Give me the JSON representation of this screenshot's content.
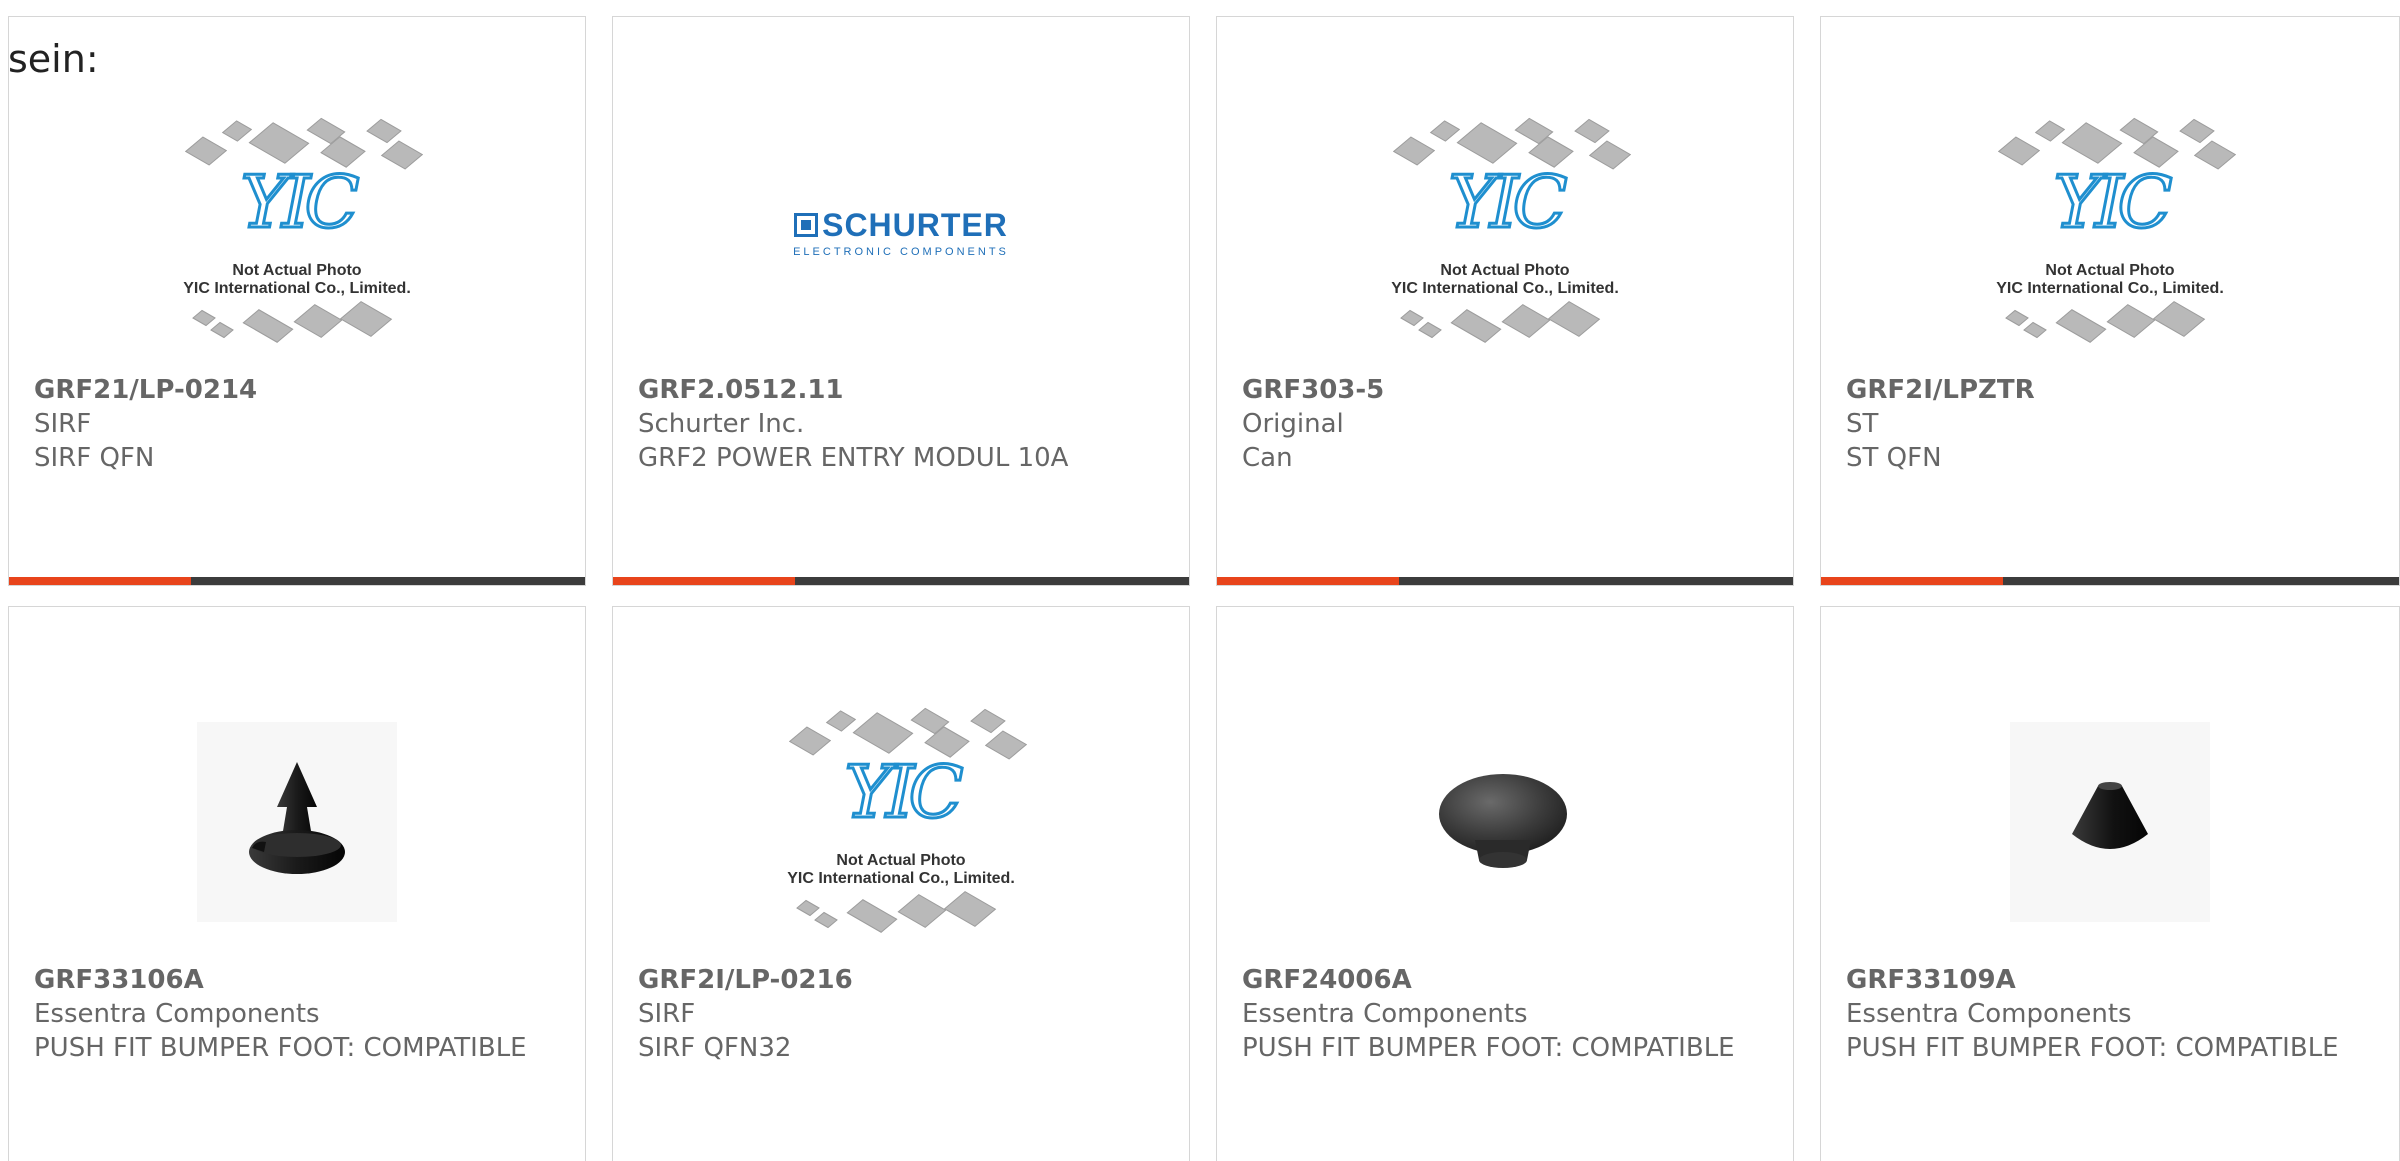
{
  "intro_text": "sein:",
  "colors": {
    "accent": "#e8441b",
    "bar": "#3c3c3c",
    "text": "#666666",
    "yic_blue": "#1f8fcf",
    "schurter_blue": "#1f6fb8"
  },
  "products": [
    {
      "part_number": "GRF21/LP-0214",
      "manufacturer": "SIRF",
      "description": "SIRF QFN",
      "image_type": "yic-placeholder",
      "image_caption_1": "Not Actual Photo",
      "image_caption_2": "YIC International Co., Limited."
    },
    {
      "part_number": "GRF2.0512.11",
      "manufacturer": "Schurter Inc.",
      "description": "GRF2 POWER ENTRY MODUL 10A",
      "image_type": "schurter-logo",
      "logo_text": "SCHURTER",
      "logo_subtext": "ELECTRONIC COMPONENTS"
    },
    {
      "part_number": "GRF303-5",
      "manufacturer": "Original",
      "description": "Can",
      "image_type": "yic-placeholder",
      "image_caption_1": "Not Actual Photo",
      "image_caption_2": "YIC International Co., Limited."
    },
    {
      "part_number": "GRF2I/LPZTR",
      "manufacturer": "ST",
      "description": "ST QFN",
      "image_type": "yic-placeholder",
      "image_caption_1": "Not Actual Photo",
      "image_caption_2": "YIC International Co., Limited."
    },
    {
      "part_number": "GRF33106A",
      "manufacturer": "Essentra Components",
      "description": "PUSH FIT BUMPER FOOT: COMPATIBLE",
      "image_type": "bumper-push-fit"
    },
    {
      "part_number": "GRF2I/LP-0216",
      "manufacturer": "SIRF",
      "description": "SIRF QFN32",
      "image_type": "yic-placeholder",
      "image_caption_1": "Not Actual Photo",
      "image_caption_2": "YIC International Co., Limited."
    },
    {
      "part_number": "GRF24006A",
      "manufacturer": "Essentra Components",
      "description": "PUSH FIT BUMPER FOOT: COMPATIBLE",
      "image_type": "bumper-round"
    },
    {
      "part_number": "GRF33109A",
      "manufacturer": "Essentra Components",
      "description": "PUSH FIT BUMPER FOOT: COMPATIBLE",
      "image_type": "bumper-cone"
    }
  ]
}
